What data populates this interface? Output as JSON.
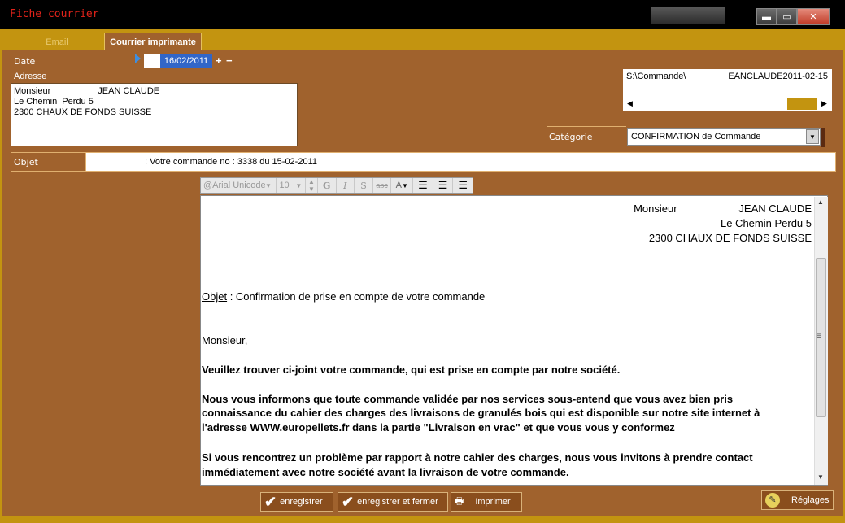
{
  "window": {
    "title": "Fiche courrier",
    "minimize_glyph": "▬",
    "maximize_glyph": "▭",
    "close_glyph": "✕"
  },
  "tabs": [
    {
      "label": "Email",
      "active": false
    },
    {
      "label": "Courrier imprimante",
      "active": true
    }
  ],
  "form": {
    "date_label": "Date",
    "date_value": "16/02/2011",
    "plus": "+",
    "minus": "−",
    "adresse_label": "Adresse",
    "adresse_lines": [
      "Monsieur                   JEAN CLAUDE",
      "Le Chemin  Perdu 5",
      "2300 CHAUX DE FONDS SUISSE"
    ],
    "path_text": "S:\\Commande\\                 EANCLAUDE2011-02-15",
    "categorie_label": "Catégorie",
    "categorie_value": "CONFIRMATION de Commande",
    "objet_label": "Objet",
    "objet_value": ": Votre  commande no : 3338 du 15-02-2011"
  },
  "toolbar": {
    "font_name": "@Arial Unicode MS",
    "font_size": "10",
    "bold": "G",
    "italic": "I",
    "underline": "S",
    "strike": "abc",
    "color": "A"
  },
  "editor": {
    "recipient": [
      "Monsieur                     JEAN CLAUDE",
      "Le Chemin  Perdu 5",
      "2300 CHAUX DE FONDS SUISSE"
    ],
    "objet_word": "Objet",
    "objet_text": " : Confirmation de prise en compte de votre commande",
    "salutation": "Monsieur,",
    "para1": "Veuillez trouver ci-joint votre commande, qui est prise en compte par notre société.",
    "para2_lines": [
      "Nous vous informons que toute commande validée par nos services sous-entend que vous avez bien pris",
      "connaissance du cahier des charges des livraisons de granulés bois qui est disponible sur notre site internet à",
      "l'adresse WWW.europellets.fr dans la partie \"Livraison en vrac\" et que vous vous y conformez"
    ],
    "para3_line1": "Si vous rencontrez un problème par rapport à notre cahier des charges, nous vous invitons à prendre contact",
    "para3_line2_a": "immédiatement avec notre société ",
    "para3_line2_u": "avant la livraison de votre commande",
    "para3_line2_b": "."
  },
  "buttons": {
    "enregistrer": "enregistrer",
    "enregistrer_fermer": "enregistrer et fermer",
    "imprimer": "Imprimer",
    "reglages": "Réglages"
  }
}
